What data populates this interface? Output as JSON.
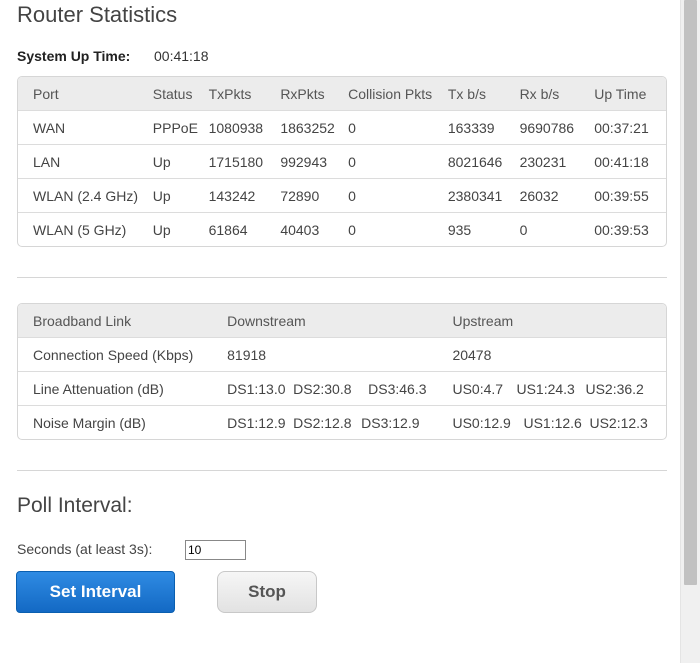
{
  "page": {
    "title": "Router Statistics"
  },
  "system": {
    "uptime_label": "System Up Time:",
    "uptime_value": "00:41:18"
  },
  "ports": {
    "headers": [
      "Port",
      "Status",
      "TxPkts",
      "RxPkts",
      "Collision Pkts",
      "Tx b/s",
      "Rx b/s",
      "Up Time"
    ],
    "rows": [
      [
        "WAN",
        "PPPoE",
        "1080938",
        "1863252",
        "0",
        "163339",
        "9690786",
        "00:37:21"
      ],
      [
        "LAN",
        "Up",
        "1715180",
        "992943",
        "0",
        "8021646",
        "230231",
        "00:41:18"
      ],
      [
        "WLAN (2.4 GHz)",
        "Up",
        "143242",
        "72890",
        "0",
        "2380341",
        "26032",
        "00:39:55"
      ],
      [
        "WLAN (5 GHz)",
        "Up",
        "61864",
        "40403",
        "0",
        "935",
        "0",
        "00:39:53"
      ]
    ]
  },
  "broadband": {
    "headers": [
      "Broadband Link",
      "Downstream",
      "Upstream"
    ],
    "rows": [
      {
        "label": "Connection Speed (Kbps)",
        "down": [
          "81918"
        ],
        "up": [
          "20478"
        ]
      },
      {
        "label": "Line Attenuation (dB)",
        "down": [
          "DS1:13.0",
          "DS2:30.8",
          "DS3:46.3"
        ],
        "up": [
          "US0:4.7",
          "US1:24.3",
          "US2:36.2"
        ]
      },
      {
        "label": "Noise Margin (dB)",
        "down": [
          "DS1:12.9",
          "DS2:12.8",
          "DS3:12.9"
        ],
        "up": [
          "US0:12.9",
          "US1:12.6",
          "US2:12.3"
        ]
      }
    ]
  },
  "poll": {
    "title": "Poll Interval:",
    "seconds_label": "Seconds (at least 3s):",
    "seconds_value": "10",
    "set_button": "Set Interval",
    "stop_button": "Stop"
  },
  "colors": {
    "primary_button": "#1b74d0",
    "header_row": "#ececec",
    "border": "#d6d6d6"
  }
}
